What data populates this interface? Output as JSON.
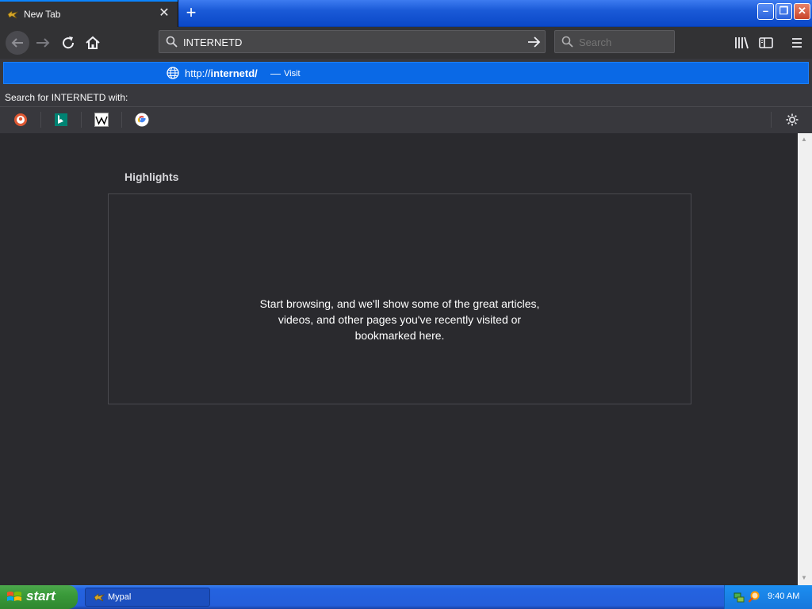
{
  "tab": {
    "title": "New Tab"
  },
  "window": {
    "minimize": "–",
    "restore": "❐",
    "close": "✕"
  },
  "navbar": {
    "url_value": "INTERNETD",
    "search_placeholder": "Search"
  },
  "popup": {
    "suggestion_url_prefix": "http://",
    "suggestion_url_bold": "internetd/",
    "suggestion_dash": "—",
    "suggestion_action": "Visit",
    "search_for": "Search for INTERNETD with:",
    "engines": [
      "duckduckgo-icon",
      "bing-icon",
      "wikipedia-icon",
      "google-icon"
    ]
  },
  "content": {
    "highlights_title": "Highlights",
    "empty_line1": "Start browsing, and we'll show some of the great articles,",
    "empty_line2": "videos, and other pages you've recently visited or",
    "empty_line3": "bookmarked here."
  },
  "taskbar": {
    "start_label": "start",
    "task_label": "Mypal",
    "clock": "9:40 AM"
  },
  "colors": {
    "accent": "#0a84ff",
    "suggestion_bg": "#0a69e6",
    "content_bg": "#2a2a2e",
    "toolbar_bg": "#323234"
  }
}
